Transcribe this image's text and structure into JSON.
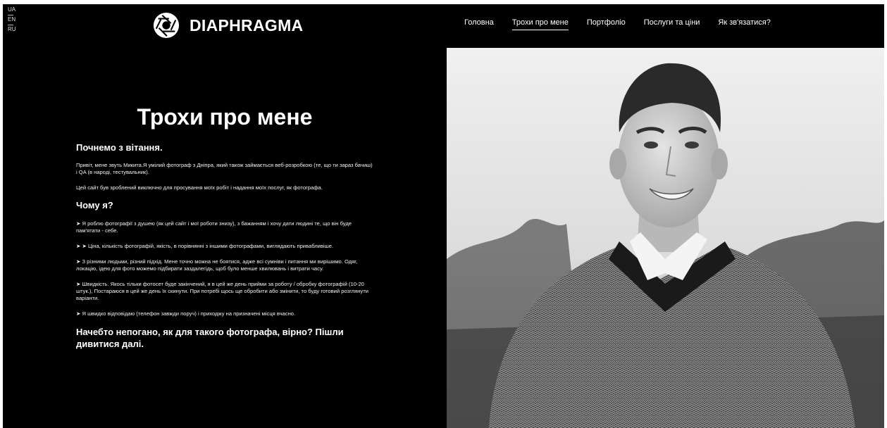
{
  "languages": [
    "UA",
    "EN",
    "RU"
  ],
  "brand": {
    "name": "DIAPHRAGMA",
    "logo_icon": "aperture-icon"
  },
  "nav": [
    {
      "label": "Головна",
      "active": false
    },
    {
      "label": "Трохи про мене",
      "active": true
    },
    {
      "label": "Портфоліо",
      "active": false
    },
    {
      "label": "Послуги та ціни",
      "active": false
    },
    {
      "label": "Як зв'язатися?",
      "active": false
    }
  ],
  "main": {
    "title": "Трохи про мене",
    "greeting_heading": "Почнемо з вітання.",
    "intro": "Привіт, мене звуть Микита.Я умілий фотограф з Дніпра, який також займається веб-розробкою (те, що ти зараз бачиш) і QA (в народі, тестувальник).",
    "purpose": "Цей сайт був зроблений виключно для просування моїх робіт і надання моїх послуг, як фотографа.",
    "why_heading": "Чому я?",
    "points": [
      "➤ Я роблю фотографії з душею (як цей сайт і мої роботи знизу), з бажанням і хочу дати людині те, що він буде пам'ятати - себе.",
      "➤ ➤ Ціна, кількість фотографій, якість, в порівнянні з іншими фотографами, виглядають привабливіше.",
      "➤ З різними людьми, різний підхід. Мене точно можна не боятися, адже всі сумніви і питання ми вирішимо. Одяг, локацію, ідею для фото можемо підбирати заздалегідь, щоб було менше хвилювань і витрати часу.",
      "➤ Швидкість. Якось тільки фотосет буде закінчений, я в цей же день прийми за роботу / обробку фотографій (10-20 штук.), Постараюся в цей же день їх скинути. При потребі щось ще обробити або змінити, то буду готовий розглянути варіанти.",
      "➤ Я швидко відповідаю (телефон завжди поруч) і приходжу на призначені місця вчасно."
    ],
    "closing": "Начебто непогано, як для такого фотографа, вірно? Пішли дивитися далі."
  },
  "colors": {
    "background": "#000000",
    "text": "#ffffff"
  }
}
